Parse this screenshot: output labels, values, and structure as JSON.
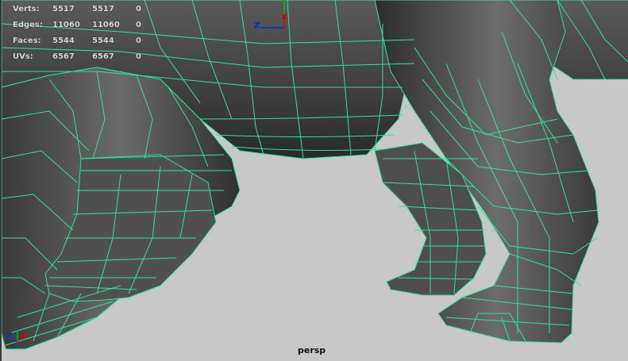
{
  "hud": {
    "rows": [
      {
        "label": "Verts:",
        "total": "5517",
        "selected": "5517",
        "uv": "0"
      },
      {
        "label": "Edges:",
        "total": "11060",
        "selected": "11060",
        "uv": "0"
      },
      {
        "label": "Faces:",
        "total": "5544",
        "selected": "5544",
        "uv": "0"
      },
      {
        "label": "UVs:",
        "total": "6567",
        "selected": "6567",
        "uv": "0"
      }
    ]
  },
  "camera_label": "persp",
  "view_axis": {
    "z": "Z",
    "x": "X",
    "y": "Y"
  },
  "corner_axis": {
    "z": "Z",
    "x": "X"
  },
  "colors": {
    "background": "#c8c8c8",
    "mesh_fill": "#4a4a4a",
    "wire": "#2fe39a",
    "hud_text": "#d8d8d8",
    "axis_x": "#d40000",
    "axis_y": "#00c000",
    "axis_z": "#0030d0"
  }
}
